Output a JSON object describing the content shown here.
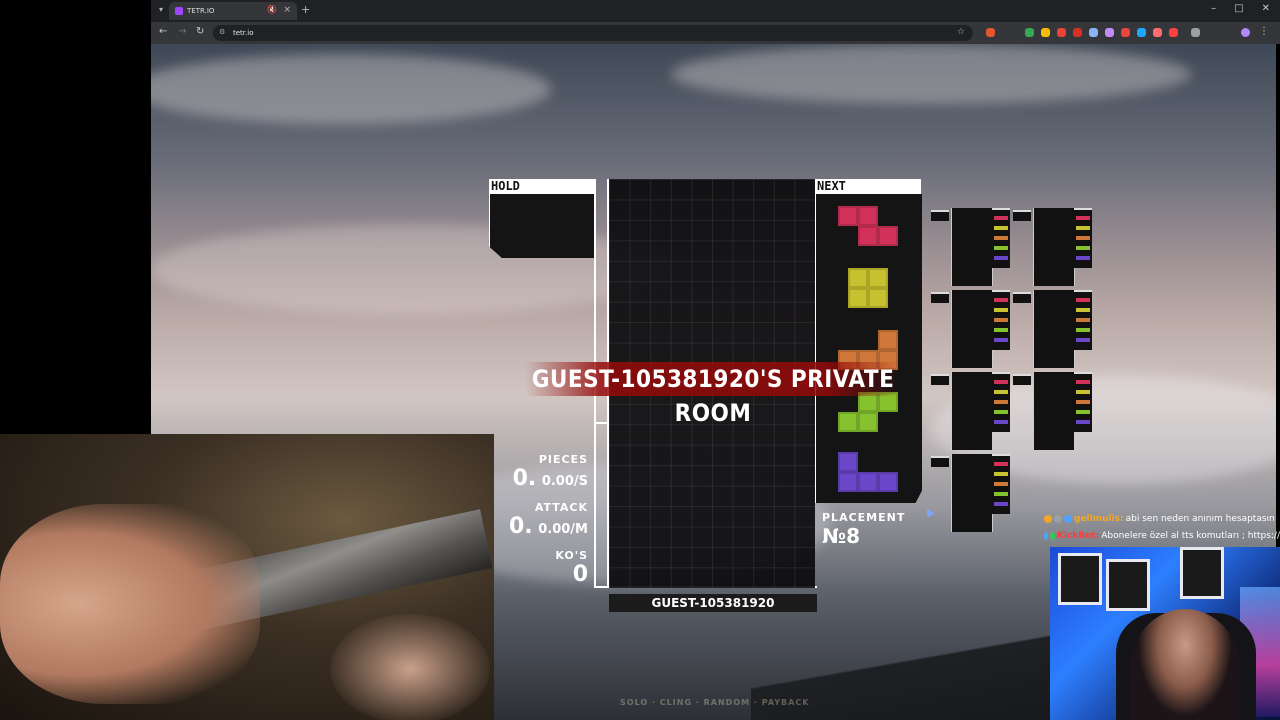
{
  "browser": {
    "tab_title": "TETR.IO",
    "url": "tetr.io",
    "new_tab": "+",
    "tab_close": "×",
    "tab_mute": "🔇",
    "back": "←",
    "forward": "→",
    "reload": "↻",
    "min": "–",
    "max": "□",
    "close": "✕"
  },
  "game": {
    "hold_label": "HOLD",
    "next_label": "NEXT",
    "room_banner": "GUEST-105381920'S PRIVATE ROOM",
    "player_name": "GUEST-105381920",
    "stats": {
      "pieces_label": "PIECES",
      "pieces_value": "0.",
      "pieces_rate": "0.00/S",
      "attack_label": "ATTACK",
      "attack_value": "0.",
      "attack_rate": "0.00/M",
      "kos_label": "KO'S",
      "kos_value": "0"
    },
    "placement_label": "PLACEMENT",
    "placement_value": "№8",
    "next_queue": [
      "Z",
      "O",
      "L",
      "S",
      "J"
    ],
    "piece_colors": {
      "Z": "#d2325a",
      "O": "#c9c230",
      "L": "#d0773a",
      "S": "#86c22e",
      "J": "#6a46c8",
      "T": "#b03aa8",
      "I": "#3ac0c0"
    },
    "bottom_hints": [
      "SOLO",
      "CLING",
      "RANDOM",
      "PAYBACK"
    ]
  },
  "chat": [
    {
      "user": "gellmulis:",
      "message": "abi sen neden anınım hesaptasın",
      "user_color": "#f5a623"
    },
    {
      "user": "KickBot:",
      "message": "Abonelere özel al tts komutları ; https://",
      "user_color": "#ff3b3b"
    }
  ]
}
